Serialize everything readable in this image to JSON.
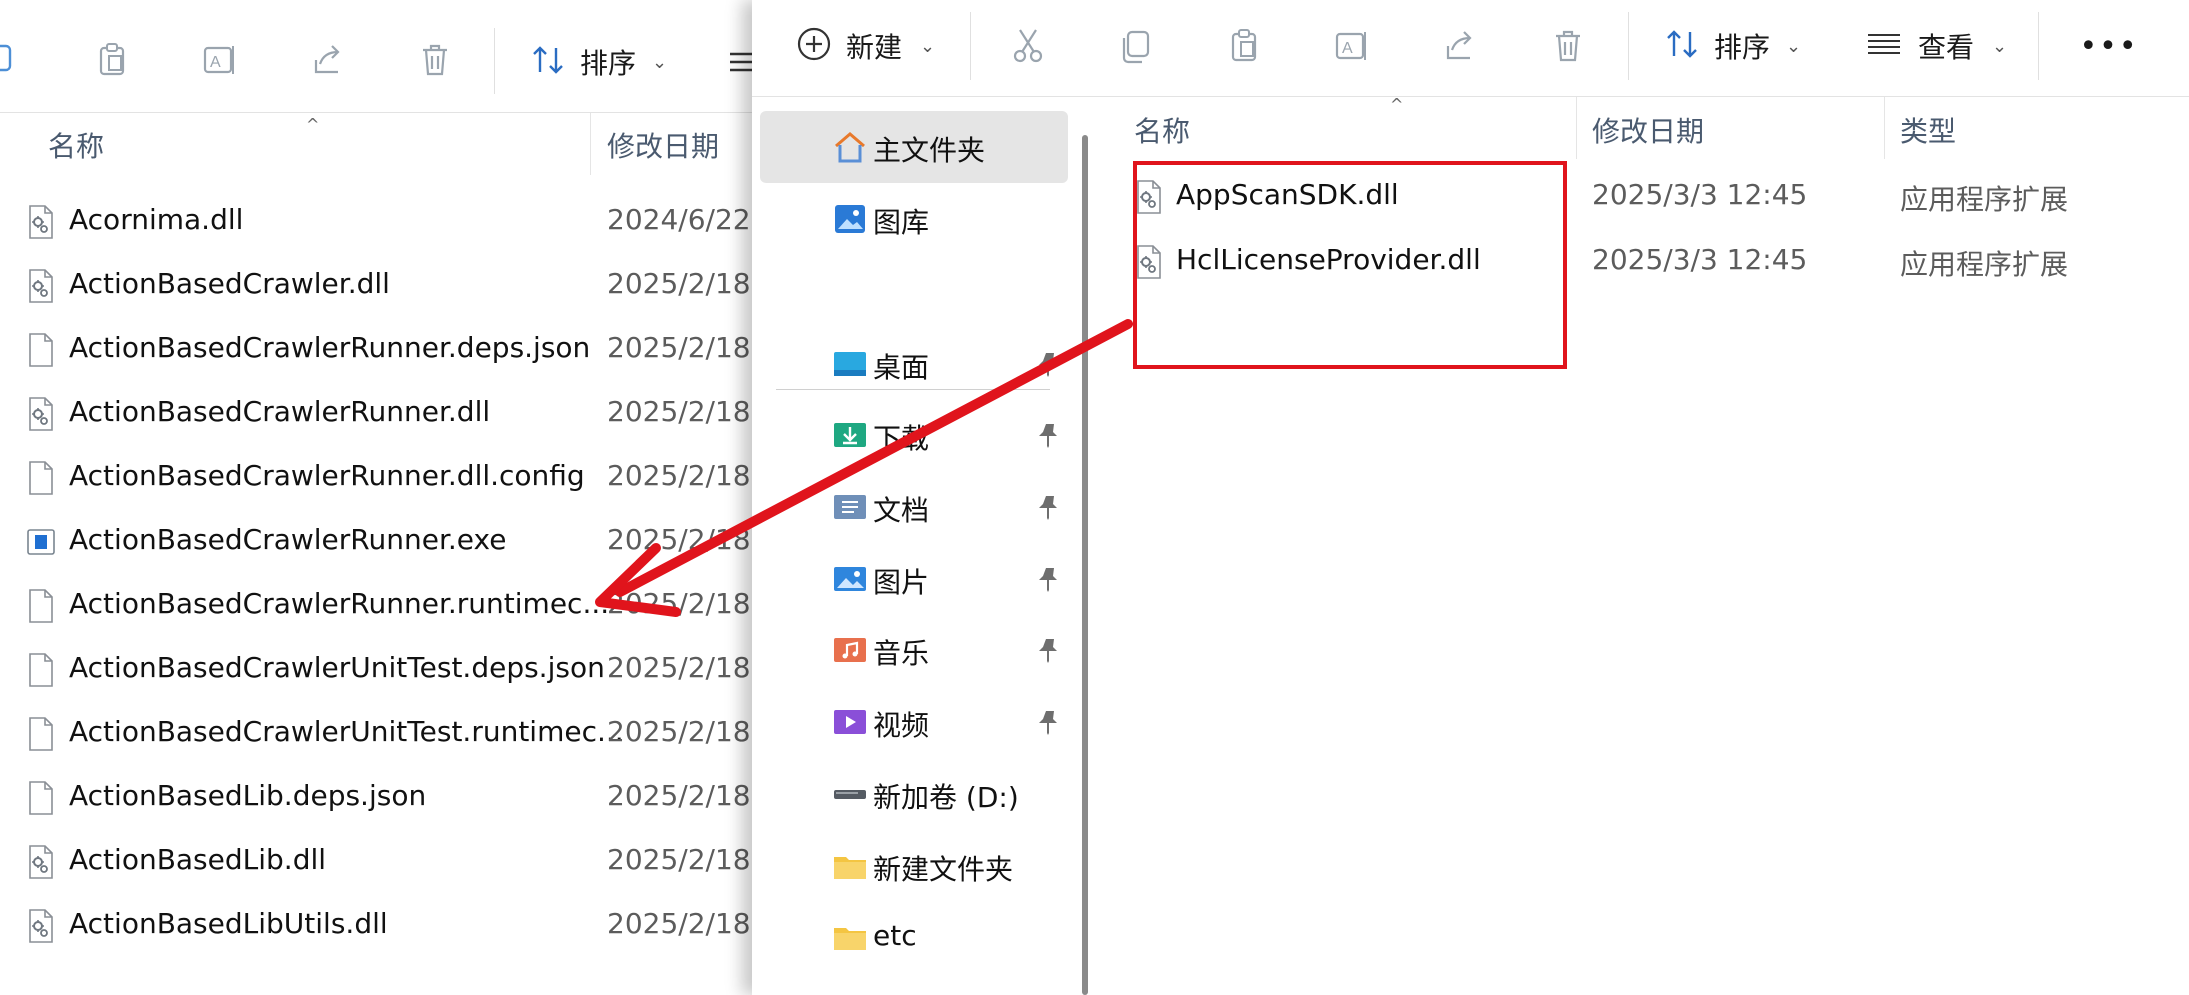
{
  "colors": {
    "annotation_red": "#e0141c",
    "header_text": "#4a5a6f",
    "selected_bg": "#e5e5e5",
    "folder_yellow": "#f4c542",
    "home_orange": "#e8792b"
  },
  "left_window": {
    "toolbar": {
      "icons": [
        "copy-icon",
        "paste-icon",
        "rename-icon",
        "share-icon",
        "delete-icon",
        "sort-icon",
        "view-icon"
      ],
      "sort_label": "排序"
    },
    "columns": {
      "name": "名称",
      "date": "修改日期"
    },
    "files": [
      {
        "name": "Acornima.dll",
        "date": "2024/6/22",
        "icon": "dll-file-icon"
      },
      {
        "name": "ActionBasedCrawler.dll",
        "date": "2025/2/18",
        "icon": "dll-file-icon"
      },
      {
        "name": "ActionBasedCrawlerRunner.deps.json",
        "date": "2025/2/18",
        "icon": "generic-file-icon"
      },
      {
        "name": "ActionBasedCrawlerRunner.dll",
        "date": "2025/2/18",
        "icon": "dll-file-icon"
      },
      {
        "name": "ActionBasedCrawlerRunner.dll.config",
        "date": "2025/2/18",
        "icon": "generic-file-icon"
      },
      {
        "name": "ActionBasedCrawlerRunner.exe",
        "date": "2025/2/18",
        "icon": "exe-file-icon"
      },
      {
        "name": "ActionBasedCrawlerRunner.runtimec...",
        "date": "2025/2/18",
        "icon": "generic-file-icon"
      },
      {
        "name": "ActionBasedCrawlerUnitTest.deps.json",
        "date": "2025/2/18",
        "icon": "generic-file-icon"
      },
      {
        "name": "ActionBasedCrawlerUnitTest.runtimec...",
        "date": "2025/2/18",
        "icon": "generic-file-icon"
      },
      {
        "name": "ActionBasedLib.deps.json",
        "date": "2025/2/18",
        "icon": "generic-file-icon"
      },
      {
        "name": "ActionBasedLib.dll",
        "date": "2025/2/18",
        "icon": "dll-file-icon"
      },
      {
        "name": "ActionBasedLibUtils.dll",
        "date": "2025/2/18",
        "icon": "dll-file-icon"
      }
    ]
  },
  "right_window": {
    "toolbar": {
      "new_label": "新建",
      "sort_label": "排序",
      "view_label": "查看",
      "more_label": "•••",
      "icons": [
        "new-icon",
        "cut-icon",
        "copy-icon",
        "paste-icon",
        "rename-icon",
        "share-icon",
        "delete-icon",
        "sort-icon",
        "view-icon",
        "more-icon"
      ]
    },
    "nav": {
      "items": [
        {
          "label": "主文件夹",
          "icon": "home-icon",
          "selected": true,
          "pinned": false
        },
        {
          "label": "图库",
          "icon": "gallery-icon",
          "selected": false,
          "pinned": false
        },
        {
          "label": "桌面",
          "icon": "desktop-icon",
          "selected": false,
          "pinned": true
        },
        {
          "label": "下载",
          "icon": "downloads-icon",
          "selected": false,
          "pinned": true
        },
        {
          "label": "文档",
          "icon": "documents-icon",
          "selected": false,
          "pinned": true
        },
        {
          "label": "图片",
          "icon": "pictures-icon",
          "selected": false,
          "pinned": true
        },
        {
          "label": "音乐",
          "icon": "music-icon",
          "selected": false,
          "pinned": true
        },
        {
          "label": "视频",
          "icon": "videos-icon",
          "selected": false,
          "pinned": true
        },
        {
          "label": "新加卷 (D:)",
          "icon": "drive-icon",
          "selected": false,
          "pinned": false
        },
        {
          "label": "新建文件夹",
          "icon": "folder-icon",
          "selected": false,
          "pinned": false
        },
        {
          "label": "etc",
          "icon": "folder-icon",
          "selected": false,
          "pinned": false
        }
      ]
    },
    "columns": {
      "name": "名称",
      "date": "修改日期",
      "type": "类型"
    },
    "files": [
      {
        "name": "AppScanSDK.dll",
        "date": "2025/3/3 12:45",
        "type": "应用程序扩展",
        "icon": "dll-file-icon"
      },
      {
        "name": "HclLicenseProvider.dll",
        "date": "2025/3/3 12:45",
        "type": "应用程序扩展",
        "icon": "dll-file-icon"
      }
    ]
  }
}
